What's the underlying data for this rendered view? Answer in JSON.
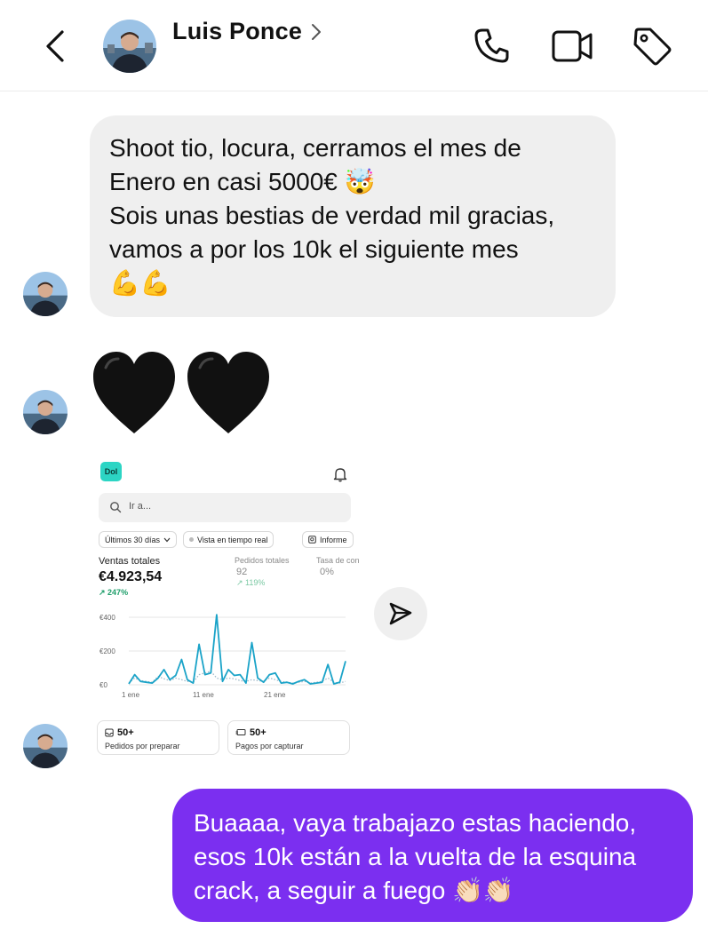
{
  "header": {
    "contact_name": "Luis Ponce",
    "back_icon": "chevron-left-icon",
    "actions": [
      "phone-icon",
      "video-camera-icon",
      "tag-icon"
    ]
  },
  "messages": {
    "incoming_1": {
      "lines": [
        "Shoot tio, locura, cerramos el mes de",
        "Enero en casi 5000€",
        "Sois unas bestias de verdad mil gracias,",
        "vamos a por los 10k el siguiente mes"
      ],
      "emoji_mindblown": "🤯",
      "emoji_flex": "💪💪"
    },
    "incoming_2": {
      "hearts": "🖤🖤"
    },
    "incoming_3": {
      "screenshot": {
        "logo_text": "Dol",
        "search_placeholder": "Ir a...",
        "chips": [
          "Últimos 30 días",
          "Vista en tiempo real",
          "Informe"
        ],
        "metrics": {
          "ventas_label": "Ventas totales",
          "ventas_value": "€4.923,54",
          "ventas_growth": "247%",
          "pedidos_label": "Pedidos totales",
          "pedidos_value": "92",
          "pedidos_growth": "119%",
          "tasa_label": "Tasa de con",
          "tasa_value": "0%"
        },
        "chart_data": {
          "type": "line",
          "y_ticks": [
            "€400",
            "€200",
            "€0"
          ],
          "x_ticks": [
            "1 ene",
            "11 ene",
            "21 ene"
          ],
          "ylim": [
            0,
            400
          ],
          "series": [
            {
              "values": [
                5,
                60,
                20,
                15,
                10,
                40,
                90,
                30,
                55,
                150,
                30,
                10,
                240,
                60,
                70,
                415,
                20,
                90,
                55,
                60,
                10,
                250,
                40,
                15,
                60,
                70,
                10,
                15,
                5,
                20,
                30,
                5,
                10,
                15,
                120,
                5,
                15,
                140
              ],
              "style": "solid",
              "color": "#1aa3c8"
            },
            {
              "values": [
                10,
                40,
                25,
                20,
                15,
                50,
                35,
                25,
                40,
                30,
                20,
                15,
                60,
                70,
                80,
                40,
                30,
                40,
                35,
                25,
                20,
                30,
                25,
                20,
                40,
                30,
                20,
                15,
                10,
                15,
                20,
                10,
                15,
                20,
                40,
                15,
                10,
                20
              ],
              "style": "dotted",
              "color": "#9fb8c8"
            }
          ]
        },
        "tiles": [
          {
            "value": "50+",
            "label": "Pedidos por preparar",
            "icon": "inbox-icon"
          },
          {
            "value": "50+",
            "label": "Pagos por capturar",
            "icon": "card-payment-icon"
          }
        ]
      },
      "share_icon": "paper-plane-icon"
    },
    "outgoing_1": {
      "lines": [
        "Buaaaa, vaya trabajazo estas haciendo,",
        "esos 10k están a la vuelta de la esquina",
        "crack, a seguir a fuego"
      ],
      "emoji_clap": "👏🏻👏🏻"
    }
  }
}
